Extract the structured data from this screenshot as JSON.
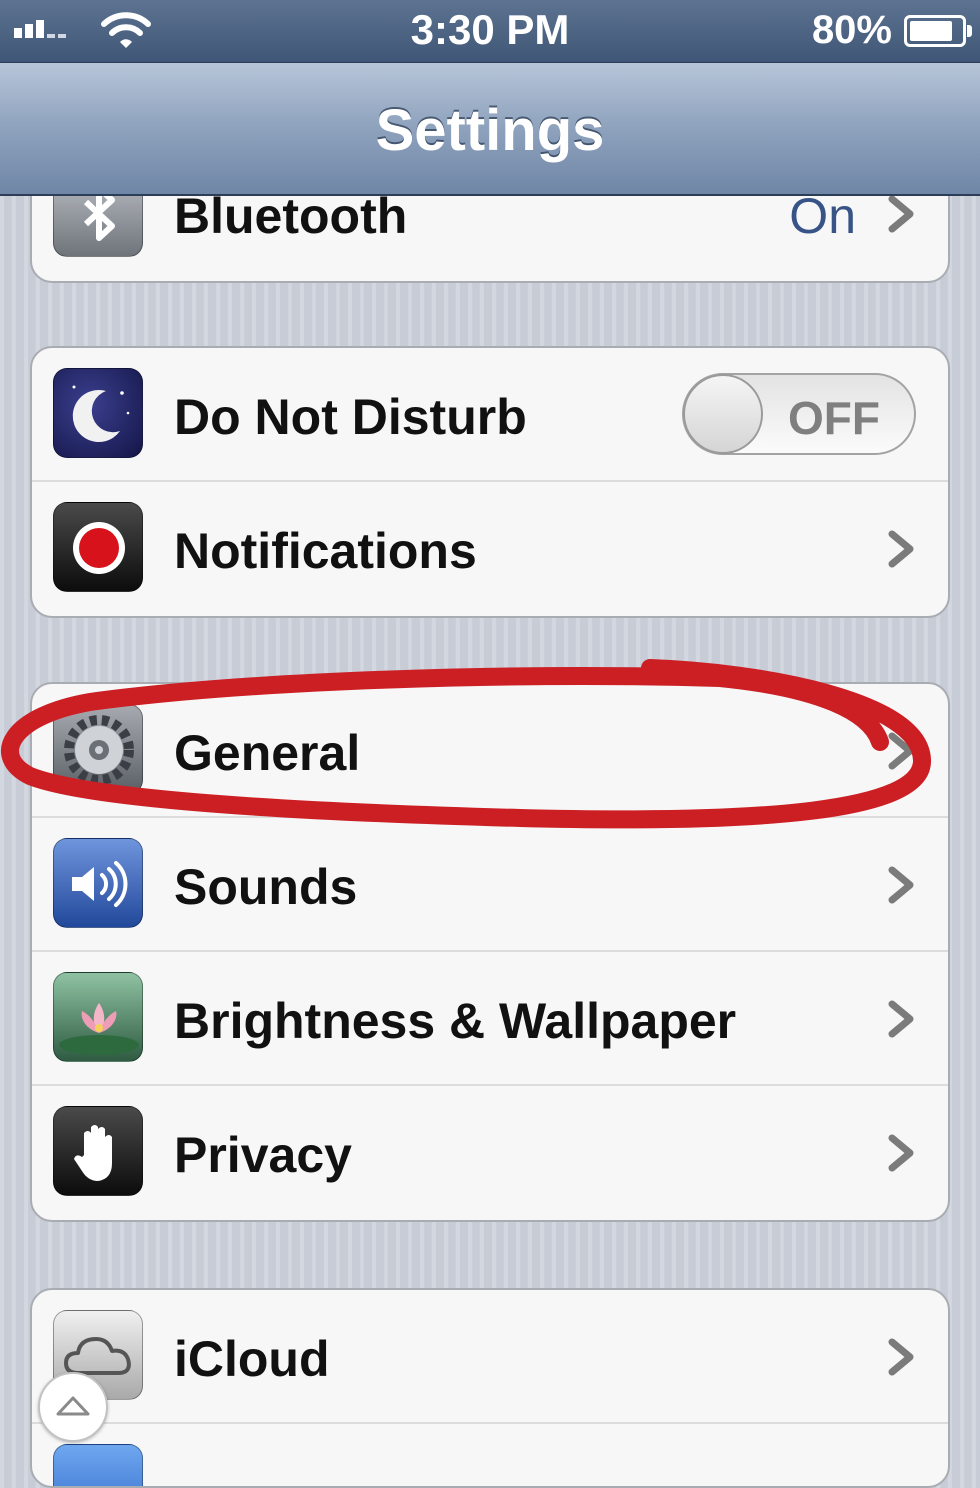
{
  "status_bar": {
    "time": "3:30 PM",
    "battery_percent": "80%",
    "battery_level": 0.8,
    "signal_bars": 3,
    "wifi": "wifi-icon"
  },
  "nav": {
    "title": "Settings"
  },
  "groups": [
    {
      "rows": [
        {
          "icon": "bluetooth-icon",
          "label": "Bluetooth",
          "value": "On",
          "chevron": true
        }
      ]
    },
    {
      "rows": [
        {
          "icon": "moon-icon",
          "label": "Do Not Disturb",
          "toggle": "OFF"
        },
        {
          "icon": "notifications-icon",
          "label": "Notifications",
          "chevron": true
        }
      ]
    },
    {
      "rows": [
        {
          "icon": "gear-icon",
          "label": "General",
          "chevron": true,
          "circled": true
        },
        {
          "icon": "speaker-icon",
          "label": "Sounds",
          "chevron": true
        },
        {
          "icon": "flower-icon",
          "label": "Brightness & Wallpaper",
          "chevron": true
        },
        {
          "icon": "hand-icon",
          "label": "Privacy",
          "chevron": true
        }
      ]
    },
    {
      "rows": [
        {
          "icon": "cloud-icon",
          "label": "iCloud",
          "chevron": true
        },
        {
          "icon": "mail-icon",
          "label": "",
          "chevron": false
        }
      ]
    }
  ],
  "colors": {
    "nav_bar": "#8ea2bd",
    "value_text": "#385487",
    "annotation_circle": "#cc1f24",
    "moon_icon_bg": "#1c1f5e",
    "sounds_icon_bg": "#3a63b8"
  }
}
